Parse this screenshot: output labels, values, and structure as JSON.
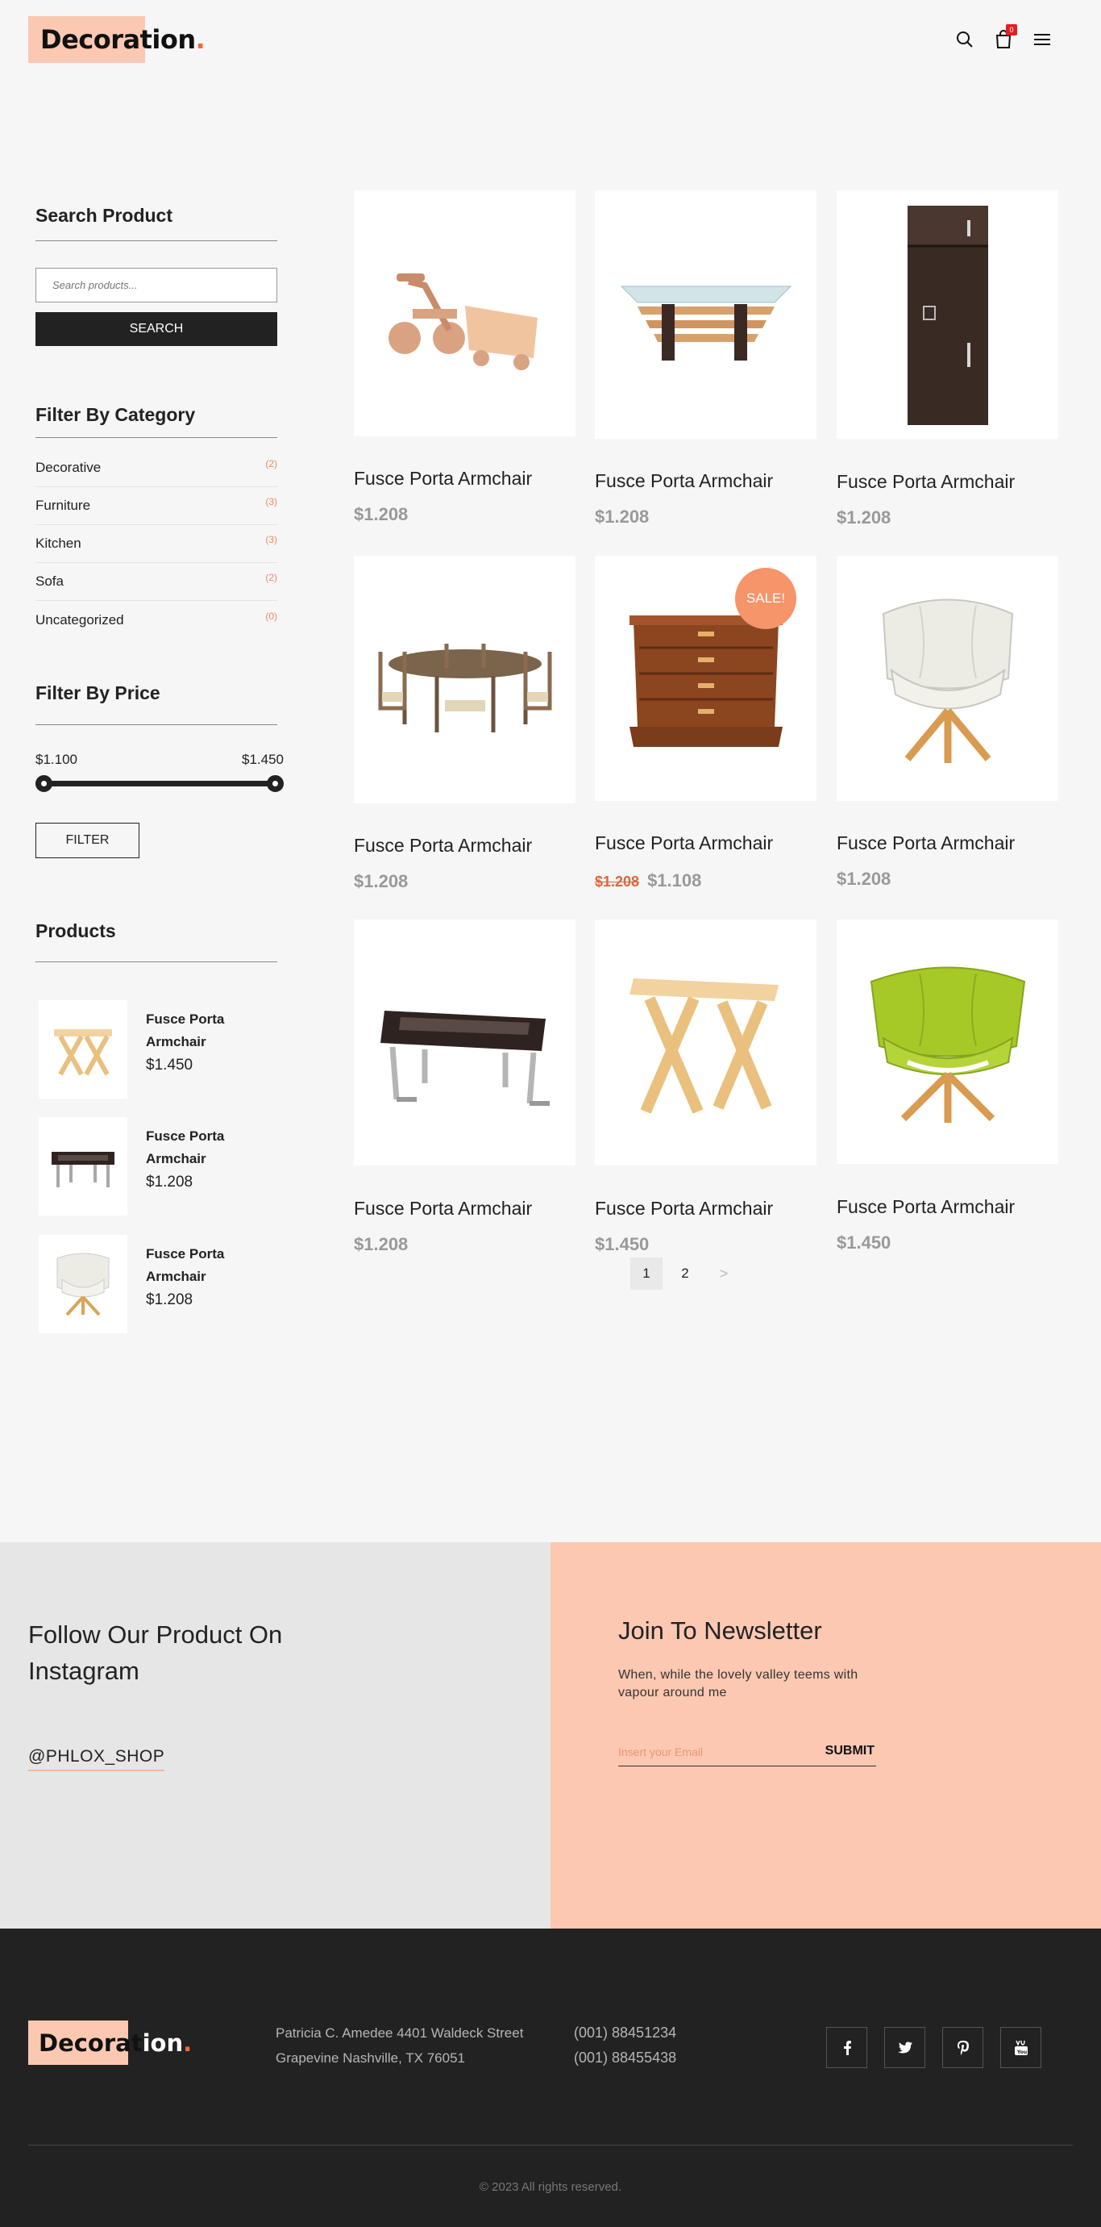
{
  "header": {
    "logo_text": "Decoration",
    "logo_dot": ".",
    "cart_count": "0",
    "icons": [
      "search-icon",
      "cart-icon",
      "menu-icon"
    ]
  },
  "sidebar": {
    "search_title": "Search Product",
    "search_placeholder": "Search products...",
    "search_button": "SEARCH",
    "category_title": "Filter By Category",
    "categories": [
      {
        "label": "Decorative",
        "count": "(2)"
      },
      {
        "label": "Furniture",
        "count": "(3)"
      },
      {
        "label": "Kitchen",
        "count": "(3)"
      },
      {
        "label": "Sofa",
        "count": "(2)"
      },
      {
        "label": "Uncategorized",
        "count": "(0)"
      }
    ],
    "price_title": "Filter By Price",
    "price_min": "$1.100",
    "price_max": "$1.450",
    "filter_button": "FILTER",
    "products_title": "Products",
    "products": [
      {
        "name": "Fusce Porta Armchair",
        "price": "$1.450",
        "icon": "wooden-table"
      },
      {
        "name": "Fusce Porta Armchair",
        "price": "$1.208",
        "icon": "foosball-table"
      },
      {
        "name": "Fusce Porta Armchair",
        "price": "$1.208",
        "icon": "white-armchair"
      }
    ]
  },
  "grid": {
    "products": [
      {
        "title": "Fusce Porta Armchair",
        "price": "$1.208",
        "icon": "toy-tricycle"
      },
      {
        "title": "Fusce Porta Armchair",
        "price": "$1.208",
        "icon": "glass-table"
      },
      {
        "title": "Fusce Porta Armchair",
        "price": "$1.208",
        "icon": "dark-wardrobe"
      },
      {
        "title": "Fusce Porta Armchair",
        "price": "$1.208",
        "icon": "dining-set"
      },
      {
        "title": "Fusce Porta Armchair",
        "old_price": "$1.208",
        "price": "$1.108",
        "badge": "SALE!",
        "icon": "chest-of-drawers"
      },
      {
        "title": "Fusce Porta Armchair",
        "price": "$1.208",
        "icon": "white-armchair"
      },
      {
        "title": "Fusce Porta Armchair",
        "price": "$1.208",
        "icon": "foosball-table"
      },
      {
        "title": "Fusce Porta Armchair",
        "price": "$1.450",
        "icon": "wooden-table"
      },
      {
        "title": "Fusce Porta Armchair",
        "price": "$1.450",
        "icon": "green-armchair"
      }
    ],
    "pagination": [
      "1",
      "2",
      ">"
    ]
  },
  "instagram": {
    "heading": "Follow Our Product On Instagram",
    "handle": "@PHLOX_SHOP"
  },
  "newsletter": {
    "heading": "Join To Newsletter",
    "text": "When, while the lovely valley teems with vapour around me",
    "placeholder": "Insert your Email",
    "submit": "SUBMIT"
  },
  "footer": {
    "logo_text_dark": "Decorat",
    "logo_text_light": "ion",
    "logo_dot": ".",
    "address_line1": "Patricia C. Amedee 4401 Waldeck Street",
    "address_line2": "Grapevine Nashville, TX 76051",
    "phone1": "(001) 88451234",
    "phone2": "(001) 88455438",
    "socials": [
      "facebook-icon",
      "twitter-icon",
      "pinterest-icon",
      "youtube-icon"
    ],
    "copyright": "© 2023 All rights reserved."
  },
  "colors": {
    "accent": "#fcc8b1",
    "accent_dark": "#f26a3b",
    "sale": "#f6946a",
    "footer_bg": "#222222"
  }
}
